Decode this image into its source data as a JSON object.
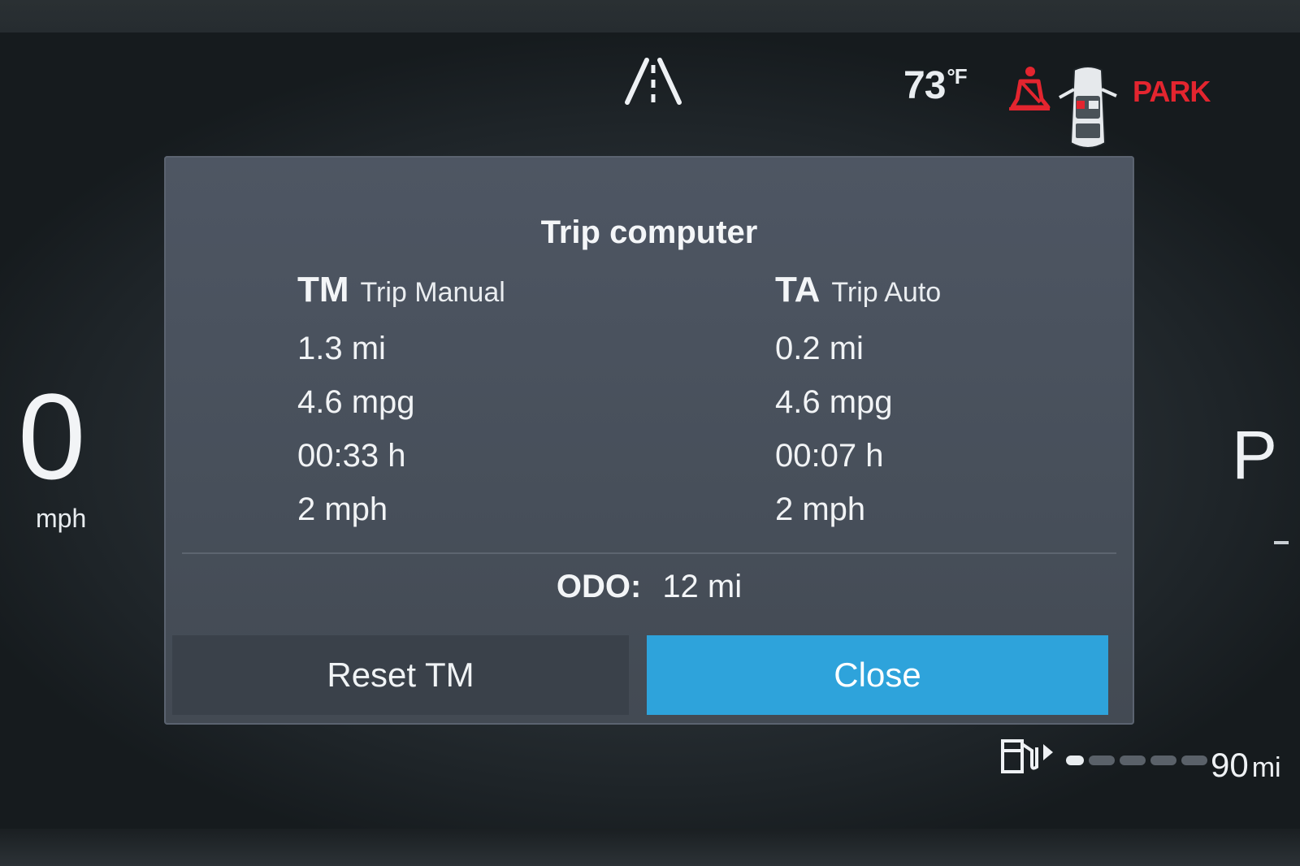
{
  "status": {
    "temperature": "73",
    "temperature_unit": "°F",
    "gear_status": "PARK",
    "icons": [
      "lane-assist-icon",
      "seatbelt-warning-icon",
      "car-door-status-icon"
    ]
  },
  "speedometer": {
    "speed": "0",
    "unit": "mph"
  },
  "gear": "P",
  "dialog": {
    "title": "Trip computer",
    "trip_manual": {
      "abbr": "TM",
      "name": "Trip Manual",
      "distance": "1.3 mi",
      "economy": "4.6 mpg",
      "time": "00:33 h",
      "avg_speed": "2 mph"
    },
    "trip_auto": {
      "abbr": "TA",
      "name": "Trip Auto",
      "distance": "0.2 mi",
      "economy": "4.6 mpg",
      "time": "00:07 h",
      "avg_speed": "2 mph"
    },
    "odo_label": "ODO:",
    "odo_value": "12 mi",
    "reset_label": "Reset TM",
    "close_label": "Close"
  },
  "fuel": {
    "range_value": "90",
    "range_unit": "mi",
    "level_fraction": 0.1
  },
  "colors": {
    "accent": "#2ea3db",
    "warning": "#e3252f"
  }
}
